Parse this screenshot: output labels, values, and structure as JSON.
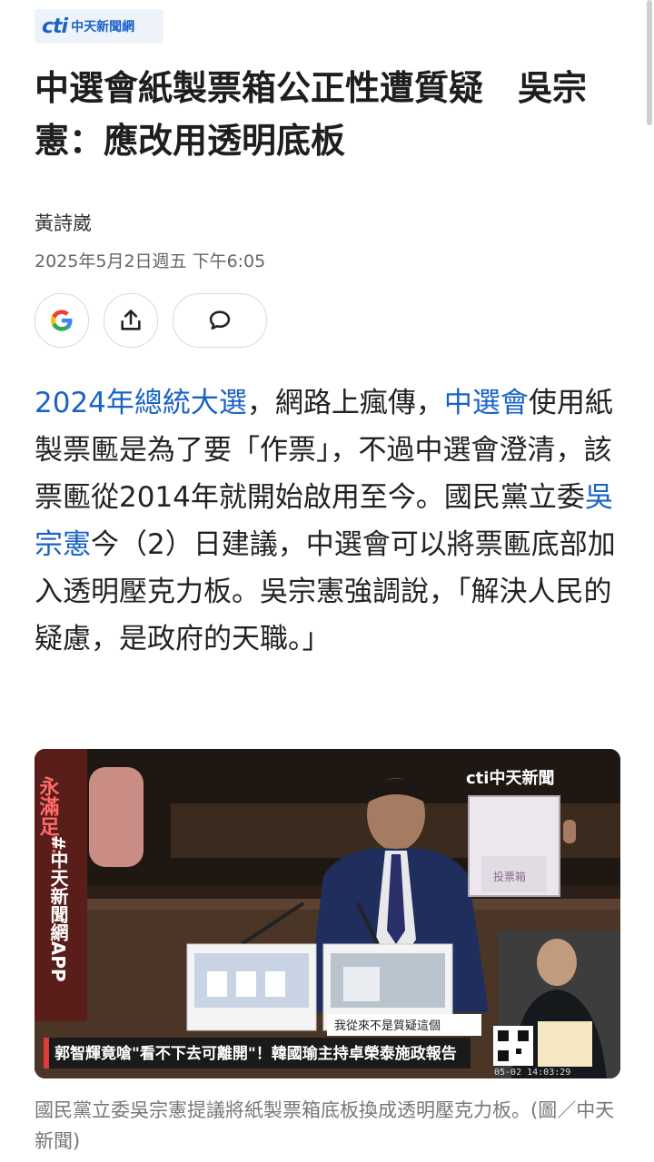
{
  "source": {
    "logo_mark": "cti",
    "logo_text": "中天新聞網"
  },
  "article": {
    "title": "中選會紙製票箱公正性遭質疑　吳宗憲：應改用透明底板",
    "author": "黃詩崴",
    "date": "2025年5月2日週五 下午6:05",
    "paragraph": {
      "link1": "2024年總統大選",
      "t1": "，網路上瘋傳，",
      "link2": "中選會",
      "t2": "使用紙製票匭是為了要「作票」，不過中選會澄清，該票匭從2014年就開始啟用至今。國民黨立委",
      "link3": "吳宗憲",
      "t3": "今（2）日建議，中選會可以將票匭底部加入透明壓克力板。吳宗憲強調說，「解決人民的疑慮，是政府的天職。」"
    },
    "caption": "國民黨立委吳宗憲提議將紙製票箱底板換成透明壓克力板。(圖／中天新聞)"
  },
  "actions": [
    {
      "icon": "google-icon"
    },
    {
      "icon": "share-icon"
    },
    {
      "icon": "comment-icon"
    }
  ],
  "photo": {
    "channel_logo": "cti中天新聞",
    "side_text_top": "永滿足！",
    "side_text": "#中天新聞網APP",
    "ticker": "郭智輝竟嗆\"看不下去可離開\"！韓國瑜主持卓榮泰施政報告",
    "subtitle": "我從來不是質疑這個",
    "box_label": "投票箱",
    "timestamp": "05-02 14:03:29"
  },
  "colors": {
    "link": "#1a62c6",
    "ticker_bg": "#1a1a1a",
    "ticker_text": "#ffffff"
  }
}
